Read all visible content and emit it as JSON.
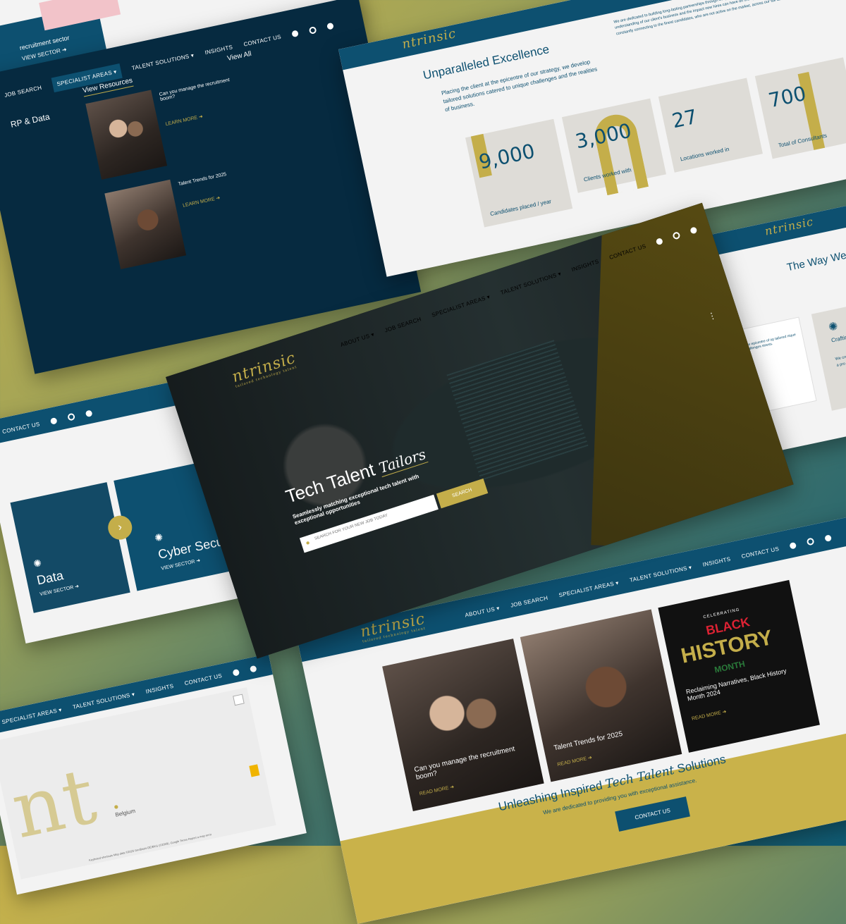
{
  "nav": {
    "about": "ABOUT US ▾",
    "job_search": "JOB SEARCH",
    "specialist": "SPECIALIST AREAS ▾",
    "talent": "TALENT SOLUTIONS ▾",
    "insights": "INSIGHTS",
    "contact": "CONTACT US"
  },
  "logo": {
    "text": "ntrinsic",
    "tagline": "tailored technology talent"
  },
  "topleft": {
    "recruitment_text": "recruitment sector",
    "view_sector": "VIEW SECTOR ➜"
  },
  "menu_panel": {
    "view_all": "View All",
    "view_resources": "View Resources",
    "erp": "RP & Data",
    "article1_title": "Can you manage the recruitment boom?",
    "article1_link": "LEARN MORE ➜",
    "article2_title": "Talent Trends for 2025",
    "article2_link": "LEARN MORE ➜"
  },
  "excellence": {
    "title": "Unparalleled Excellence",
    "left_text": "Placing the client at the epicentre of our strategy, we develop tailored solutions catered to unique challenges and the realities of business.",
    "right_text": "We are dedicated to building long-lasting partnerships through bespoke, tailored services that allow us to showcase an understanding of our client's business and the impact new hires can have on their projects. What's more, we are constantly connecting to the finest candidates, who are not active on the market, across our full talent spectrum.",
    "stats": [
      {
        "value": "9,000",
        "label": "Candidates placed / year"
      },
      {
        "value": "3,000",
        "label": "Clients worked with"
      },
      {
        "value": "27",
        "label": "Locations worked in"
      },
      {
        "value": "700",
        "label": "Total of Consultants"
      }
    ]
  },
  "way": {
    "title": "The Way We",
    "card_title": "Crafting Cand Persona",
    "card_text": "We create a co description and ensuring a pro senior appoi",
    "left_text": "ns e epicentre of op tailored nique challenges siness."
  },
  "hero": {
    "title_plain": "Tech Talent",
    "title_script": "Tailors",
    "subtitle": "Seamlessly matching exceptional tech talent with exceptional opportunities",
    "placeholder": "SEARCH FOR YOUR NEW JOB TODAY",
    "search_button": "SEARCH"
  },
  "sectors": [
    {
      "name": "Data",
      "link": "VIEW SECTOR ➜"
    },
    {
      "name": "Cyber Secu",
      "link": "VIEW SECTOR ➜"
    }
  ],
  "insights": {
    "card1_title": "Can you manage the recruitment boom?",
    "card1_link": "READ MORE ➜",
    "card2_title": "Talent Trends for 2025",
    "card2_link": "READ MORE ➜",
    "card3_kicker": "CELEBRATING",
    "card3_word1": "BLACK",
    "card3_word2": "HISTORY",
    "card3_word3": "MONTH",
    "card3_title": "Reclaiming Narratives, Black History Month 2024",
    "card3_link": "READ MORE ➜",
    "tagline_plain": "Unleashing Inspired",
    "tagline_script": "Tech Talent",
    "tagline_end": "Solutions",
    "tagline_sub": "We are dedicated to providing you with exceptional assistance.",
    "contact_button": "CONTACT US"
  },
  "map": {
    "place": "Belgium",
    "attribution": "Map data ©2025 GeoBasis-DE/BKG (©2009), Google",
    "terms": "Terms",
    "report": "Report a map error",
    "shortcuts": "Keyboard shortcuts"
  },
  "colors": {
    "navy": "#062a40",
    "teal": "#0d5070",
    "gold": "#c4ae4a",
    "light": "#f3f3f3"
  }
}
